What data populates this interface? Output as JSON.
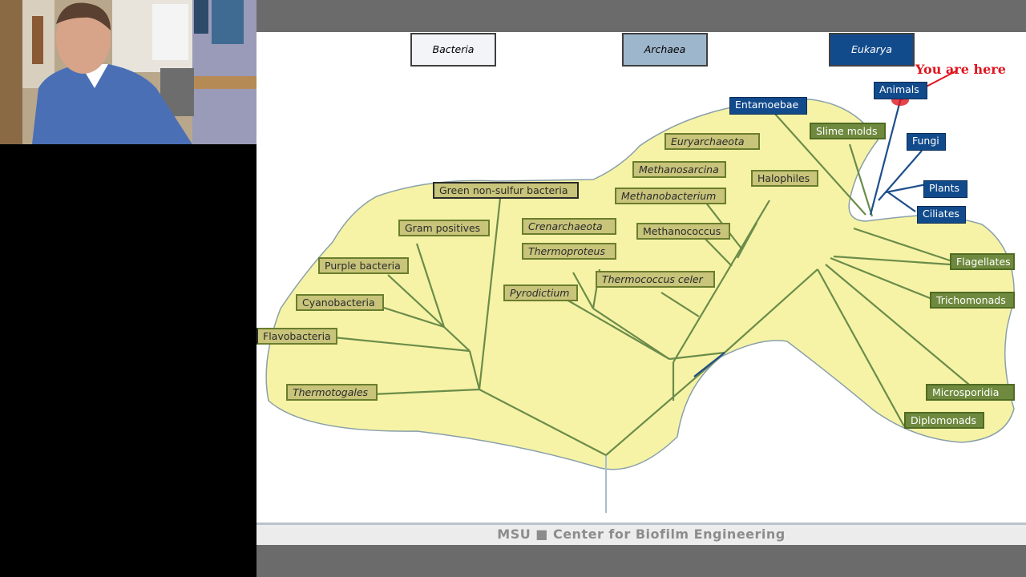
{
  "colors": {
    "blob_fill": "#f6f3a6",
    "branch_green": "#6b8c4a",
    "eukarya_blue": "#124b8c",
    "highlight_red": "#e0141e"
  },
  "domains": {
    "bacteria": "Bacteria",
    "archaea": "Archaea",
    "eukarya": "Eukarya"
  },
  "annotation": "You are here",
  "bacteria_groups": {
    "green_nonsulfur": "Green non-sulfur bacteria",
    "gram_positives": "Gram positives",
    "purple": "Purple bacteria",
    "cyanobacteria": "Cyanobacteria",
    "flavobacteria": "Flavobacteria",
    "thermotogales": "Thermotogales"
  },
  "archaea_groups": {
    "euryarchaeota": "Euryarchaeota",
    "methanosarcina": "Methanosarcina",
    "halophiles": "Halophiles",
    "methanobacterium": "Methanobacterium",
    "crenarchaeota": "Crenarchaeota",
    "methanococcus": "Methanococcus",
    "thermoproteus": "Thermoproteus",
    "thermococcus": "Thermococcus celer",
    "pyrodictium": "Pyrodictium"
  },
  "eukarya_groups": {
    "entamoebae": "Entamoebae",
    "slime_molds": "Slime molds",
    "animals": "Animals",
    "fungi": "Fungi",
    "plants": "Plants",
    "ciliates": "Ciliates",
    "flagellates": "Flagellates",
    "trichomonads": "Trichomonads",
    "microsporidia": "Microsporidia",
    "diplomonads": "Diplomonads"
  },
  "footer": "MSU  ■  Center for Biofilm Engineering"
}
